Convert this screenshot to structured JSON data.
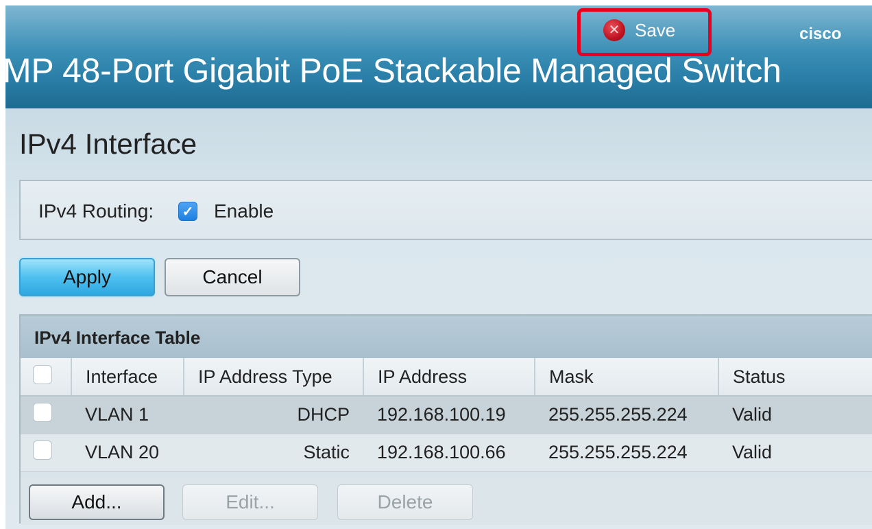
{
  "header": {
    "product_title": "MP 48-Port Gigabit PoE Stackable Managed Switch",
    "save_label": "Save",
    "save_icon": "save-alert-icon",
    "brand": "cisco",
    "highlight_color": "#e8001e"
  },
  "page": {
    "title": "IPv4 Interface"
  },
  "routing": {
    "label": "IPv4 Routing:",
    "checked": true,
    "option_label": "Enable"
  },
  "actions": {
    "apply_label": "Apply",
    "cancel_label": "Cancel"
  },
  "table": {
    "caption": "IPv4 Interface Table",
    "columns": [
      "Interface",
      "IP Address Type",
      "IP Address",
      "Mask",
      "Status"
    ],
    "rows": [
      {
        "interface": "VLAN 1",
        "type": "DHCP",
        "ip": "192.168.100.19",
        "mask": "255.255.255.224",
        "status": "Valid",
        "selected": false
      },
      {
        "interface": "VLAN 20",
        "type": "Static",
        "ip": "192.168.100.66",
        "mask": "255.255.255.224",
        "status": "Valid",
        "selected": false
      }
    ],
    "add_label": "Add...",
    "edit_label": "Edit...",
    "delete_label": "Delete"
  }
}
